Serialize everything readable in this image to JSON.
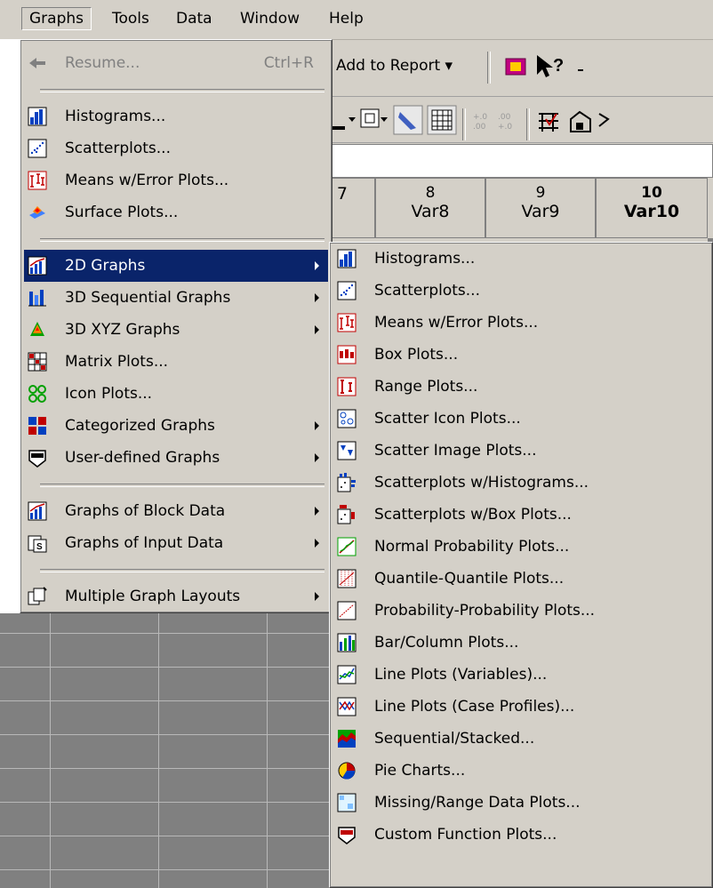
{
  "menubar": {
    "graphs": "Graphs",
    "tools": "Tools",
    "data": "Data",
    "window": "Window",
    "help": "Help"
  },
  "toolbar": {
    "add_to_report": "Add to Report ▾"
  },
  "columns": [
    {
      "num": "",
      "name": "7"
    },
    {
      "num": "8",
      "name": "Var8"
    },
    {
      "num": "9",
      "name": "Var9"
    },
    {
      "num": "10",
      "name": "Var10"
    }
  ],
  "graphs_menu": {
    "resume": "Resume...",
    "resume_shortcut": "Ctrl+R",
    "histograms": "Histograms...",
    "scatterplots": "Scatterplots...",
    "means_error": "Means w/Error Plots...",
    "surface": "Surface Plots...",
    "graphs_2d": "2D Graphs",
    "seq_3d": "3D Sequential Graphs",
    "xyz_3d": "3D XYZ Graphs",
    "matrix": "Matrix Plots...",
    "icon": "Icon Plots...",
    "categorized": "Categorized Graphs",
    "user_defined": "User-defined Graphs",
    "block_data": "Graphs of Block Data",
    "input_data": "Graphs of Input Data",
    "multiple_layouts": "Multiple Graph Layouts"
  },
  "submenu_2d": {
    "histograms": "Histograms...",
    "scatterplots": "Scatterplots...",
    "means_error": "Means w/Error Plots...",
    "box": "Box Plots...",
    "range": "Range Plots...",
    "scatter_icon": "Scatter Icon Plots...",
    "scatter_image": "Scatter Image Plots...",
    "scatter_hist": "Scatterplots w/Histograms...",
    "scatter_box": "Scatterplots w/Box Plots...",
    "normal_prob": "Normal Probability Plots...",
    "quantile": "Quantile-Quantile Plots...",
    "prob_prob": "Probability-Probability Plots...",
    "bar_column": "Bar/Column Plots...",
    "line_vars": "Line Plots (Variables)...",
    "line_cases": "Line Plots (Case Profiles)...",
    "sequential": "Sequential/Stacked...",
    "pie": "Pie Charts...",
    "missing_range": "Missing/Range Data Plots...",
    "custom_function": "Custom Function Plots..."
  }
}
